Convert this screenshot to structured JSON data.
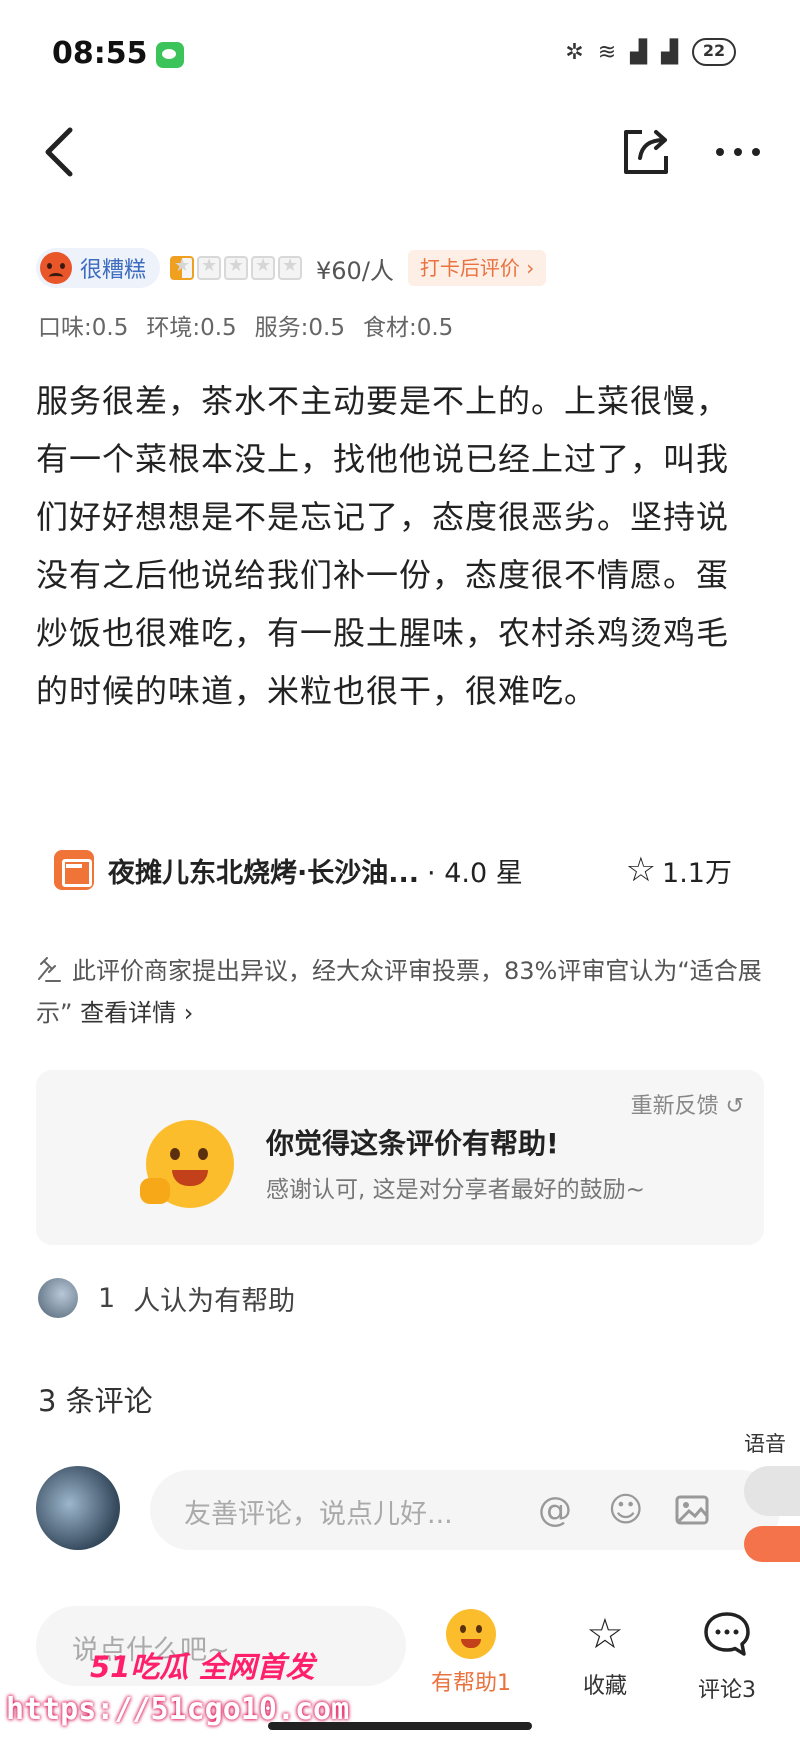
{
  "status_bar": {
    "time": "08:55",
    "battery": "22"
  },
  "review": {
    "rating_label": "很糟糕",
    "star_rating": 0.5,
    "price": "¥60/人",
    "checkin_tag": "打卡后评价 ›",
    "scores": [
      "口味:0.5",
      "环境:0.5",
      "服务:0.5",
      "食材:0.5"
    ],
    "text": "服务很差，茶水不主动要是不上的。上菜很慢，有一个菜根本没上，找他他说已经上过了，叫我们好好想想是不是忘记了，态度很恶劣。坚持说没有之后他说给我们补一份，态度很不情愿。蛋炒饭也很难吃，有一股土腥味，农村杀鸡烫鸡毛的时候的味道，米粒也很干，很难吃。"
  },
  "shop": {
    "name": "夜摊儿东北烧烤·长沙油...",
    "score": "· 4.0 星",
    "favorites": "1.1万"
  },
  "dispute": {
    "text": "此评价商家提出异议，经大众评审投票，83%评审官认为“适合展示”",
    "link": "查看详情 ›"
  },
  "helpful_card": {
    "refeedback": "重新反馈 ↺",
    "title": "你觉得这条评价有帮助!",
    "subtitle": "感谢认可, 这是对分享者最好的鼓励~"
  },
  "helpful_count": {
    "count": "1",
    "label": "人认为有帮助"
  },
  "comments": {
    "count_label": "3 条评论",
    "input_placeholder": "友善评论，说点儿好..."
  },
  "voice": {
    "label": "语音"
  },
  "bottom_bar": {
    "say_placeholder": "说点什么吧~",
    "helpful_label": "有帮助1",
    "favorite_label": "收藏",
    "comment_label": "评论3"
  },
  "watermark": {
    "logo": "51吃瓜 全网首发",
    "url": "https://51cgo10.com"
  },
  "colors": {
    "accent": "#e9723f",
    "rating_blue": "#3d6cc0",
    "star": "#f0a020"
  }
}
